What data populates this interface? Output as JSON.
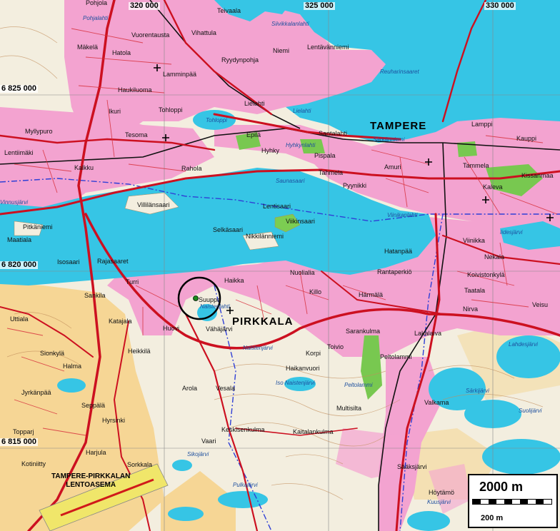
{
  "grid_labels": {
    "e320": "320 000",
    "e325": "325 000",
    "e330": "330 000",
    "n6825": "6 825 000",
    "n6820": "6 820 000",
    "n6815": "6 815 000"
  },
  "towns": {
    "tampere": "TAMPERE",
    "pirkkala": "PIRKKALA"
  },
  "places": {
    "pohjola": "Pohjola",
    "teivaala": "Teivaala",
    "vuorentausta": "Vuorentausta",
    "vihattula": "Vihattula",
    "makela": "Mäkelä",
    "hatola": "Hatola",
    "ryydynpohja": "Ryydynpohja",
    "niemi": "Niemi",
    "lentavanniemi": "Lentävänniemi",
    "lamminpaa": "Lamminpää",
    "haukiluoma": "Haukiluoma",
    "ikuri": "Ikuri",
    "tohloppi": "Tohloppi",
    "lielahti": "Lielahti",
    "myllypuro": "Myllypuro",
    "tesoma": "Tesoma",
    "epila": "Epilä",
    "santalahti": "Santalahti",
    "lamppi": "Lamppi",
    "kauppi": "Kauppi",
    "lentiimaki": "Lentiimäki",
    "kalkku": "Kalkku",
    "hyhky": "Hyhky",
    "pispala": "Pispala",
    "rahola": "Rahola",
    "tahmela": "Tahmela",
    "amuri": "Amuri",
    "tammela": "Tammela",
    "kissanmaa": "Kissanmaa",
    "kaleva": "Kaleva",
    "pyynikki": "Pyynikki",
    "villilansaari": "Villilänsaari",
    "lentisaari": "Lentisaari",
    "viikinsaari": "Viikinsaari",
    "pitkaniemi": "Pitkäniemi",
    "selkasaari": "Selkäsaari",
    "nikkilanniemi": "Nikkilänniemi",
    "viinikka": "Viinikka",
    "maatiala": "Maatiala",
    "hatanpaa": "Hatanpää",
    "nekala": "Nekala",
    "isosaari": "Isosaari",
    "rajasaaret": "Rajasaaret",
    "nuolialia": "Nuolialia",
    "rantaperkio": "Rantaperkiö",
    "koivistonkyla": "Koivistonkylä",
    "turri": "Turri",
    "haikka": "Haikka",
    "sankila": "Sankila",
    "killo": "Killo",
    "harmala": "Härmälä",
    "taatala": "Taatala",
    "suuppa": "Suuppa",
    "nirva": "Nirva",
    "veisu": "Veisu",
    "katajala": "Katajala",
    "uttiala": "Uttiala",
    "huovi": "Huovi",
    "vahajarvi": "Vähäjärvi",
    "sarankulma": "Sarankulma",
    "lakalaiva": "Lakalaiva",
    "heikkila": "Heikkilä",
    "toivio": "Toivio",
    "korpi": "Korpi",
    "peltolammi": "Peltolammi",
    "sionkyla": "Sionkylä",
    "halma": "Halma",
    "haikanvuori": "Haikanvuori",
    "jyrkanpaa": "Jyrkänpää",
    "arola": "Arola",
    "vesala": "Vesala",
    "seppala": "Seppälä",
    "hyrsinki": "Hyrsinki",
    "multisilta": "Multisilta",
    "valkama": "Valkama",
    "keskisenkulma": "Keskisenkulma",
    "kaitalankulma": "Kaitalankulma",
    "topparj": "Topparj",
    "vaari": "Vaari",
    "harjula": "Harjula",
    "sorkkala": "Sorkkala",
    "saaksjarvi": "Sääksjärvi",
    "kotiniitty": "Kotiniitty",
    "hoytamo": "Höytämö"
  },
  "waters": {
    "nasijarvi_hint": "Pohjalahti",
    "siivikkalanlahti": "Siivikkalanlahti",
    "reuharinsaaret": "Reuharinsaaret",
    "lielahti": "Lielahti",
    "tohloppi": "Tohloppi",
    "sarkanniemi": "Särkänniemi",
    "hyhkynlahti": "Hyhkynlahti",
    "saunasaari": "Saunasaari",
    "vinnusjarvi": "Vinnusjärvi",
    "viinikanlahti": "Viinikanlahti",
    "iidesjarvi": "Iidesjärvi",
    "naistenlahti": "Naistenlahti",
    "naistenjarvi": "Naistenjärvi",
    "isonaistenjarvi": "Iso Naistenjärvi",
    "peltolammi": "Peltolammi",
    "sarkijarvi": "Särkijärvi",
    "suolijarvi": "Suolijärvi",
    "lahdesjarvi": "Lahdesjärvi",
    "sikojarvi": "Sikojärvi",
    "pulkajarvi": "Pulkajärvi",
    "kuusjarvi": "Kuusjärvi"
  },
  "airport": {
    "line1": "TAMPERE-PIRKKALAN",
    "line2": "LENTOASEMA"
  },
  "scale": {
    "major": "2000 m",
    "minor": "200 m"
  },
  "colors": {
    "water": "#35c6e6",
    "built_up": "#f4a5d3",
    "field": "#f7d48f",
    "forest_open": "#f4efe2",
    "road": "#cc1020",
    "park": "#7ccd52",
    "boundary": "#2f3fd6",
    "marker_circle": "#000000"
  }
}
